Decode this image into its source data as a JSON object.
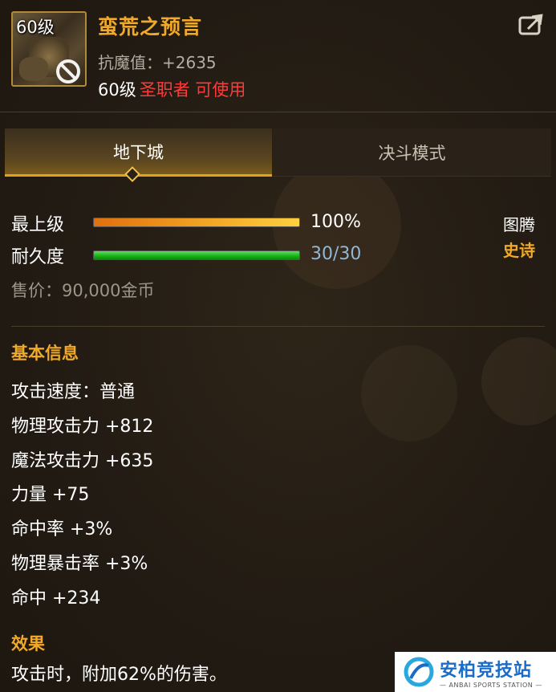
{
  "item": {
    "level_badge": "60级",
    "name": "蛮荒之预言",
    "resist_label": "抗魔值：",
    "resist_value": "+2635",
    "req_level": "60级",
    "req_class": "圣职者 可使用"
  },
  "tabs": [
    {
      "label": "地下城",
      "active": true
    },
    {
      "label": "决斗模式",
      "active": false
    }
  ],
  "bars": {
    "grade_label": "最上级",
    "grade_value": "100%",
    "grade_fraction": 1.0,
    "durability_label": "耐久度",
    "durability_value": "30/30",
    "durability_fraction": 1.0
  },
  "totem": {
    "label": "图腾",
    "value": "史诗"
  },
  "price": "售价：90,000金币",
  "basic_info": {
    "title": "基本信息",
    "attrs": [
      "攻击速度：普通",
      "物理攻击力 +812",
      "魔法攻击力 +635",
      "力量 +75",
      "命中率 +3%",
      "物理暴击率 +3%",
      "命中 +234"
    ]
  },
  "effect": {
    "title": "效果",
    "text": "攻击时，附加62%的伤害。"
  },
  "watermark": {
    "cn": "安柏竞技站",
    "en": "— ANBAI SPORTS STATION —"
  },
  "icons": [
    "forbidden-icon",
    "share-icon",
    "watermark-logo-icon"
  ],
  "colors": {
    "gold": "#f0a92a",
    "red": "#ff3a3a",
    "blue": "#8fb7d8",
    "bg": "#241d15"
  }
}
